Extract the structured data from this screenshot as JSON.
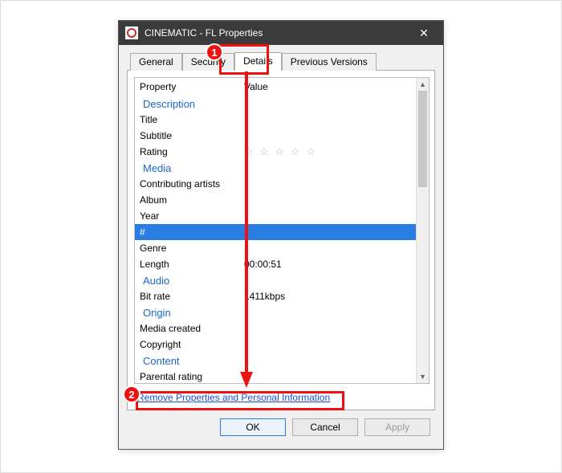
{
  "titlebar": {
    "title": "CINEMATIC - FL Properties",
    "close_glyph": "✕"
  },
  "tabs": {
    "general": "General",
    "security": "Security",
    "details": "Details",
    "previous": "Previous Versions"
  },
  "header": {
    "property": "Property",
    "value": "Value"
  },
  "groups": {
    "description": "Description",
    "media": "Media",
    "audio": "Audio",
    "origin": "Origin",
    "content": "Content"
  },
  "rows": {
    "title": {
      "k": "Title",
      "v": ""
    },
    "subtitle": {
      "k": "Subtitle",
      "v": ""
    },
    "rating": {
      "k": "Rating",
      "stars": "☆ ☆ ☆ ☆ ☆"
    },
    "contrib": {
      "k": "Contributing artists",
      "v": ""
    },
    "album": {
      "k": "Album",
      "v": ""
    },
    "year": {
      "k": "Year",
      "v": ""
    },
    "hash": {
      "k": "#",
      "v": ""
    },
    "genre": {
      "k": "Genre",
      "v": ""
    },
    "length": {
      "k": "Length",
      "v": "00:00:51"
    },
    "bitrate": {
      "k": "Bit rate",
      "v": "1411kbps"
    },
    "mediacreated": {
      "k": "Media created",
      "v": ""
    },
    "copyright": {
      "k": "Copyright",
      "v": ""
    },
    "parental": {
      "k": "Parental rating",
      "v": ""
    }
  },
  "remove_link": "Remove Properties and Personal Information",
  "buttons": {
    "ok": "OK",
    "cancel": "Cancel",
    "apply": "Apply"
  },
  "annotations": {
    "one": "1",
    "two": "2"
  }
}
